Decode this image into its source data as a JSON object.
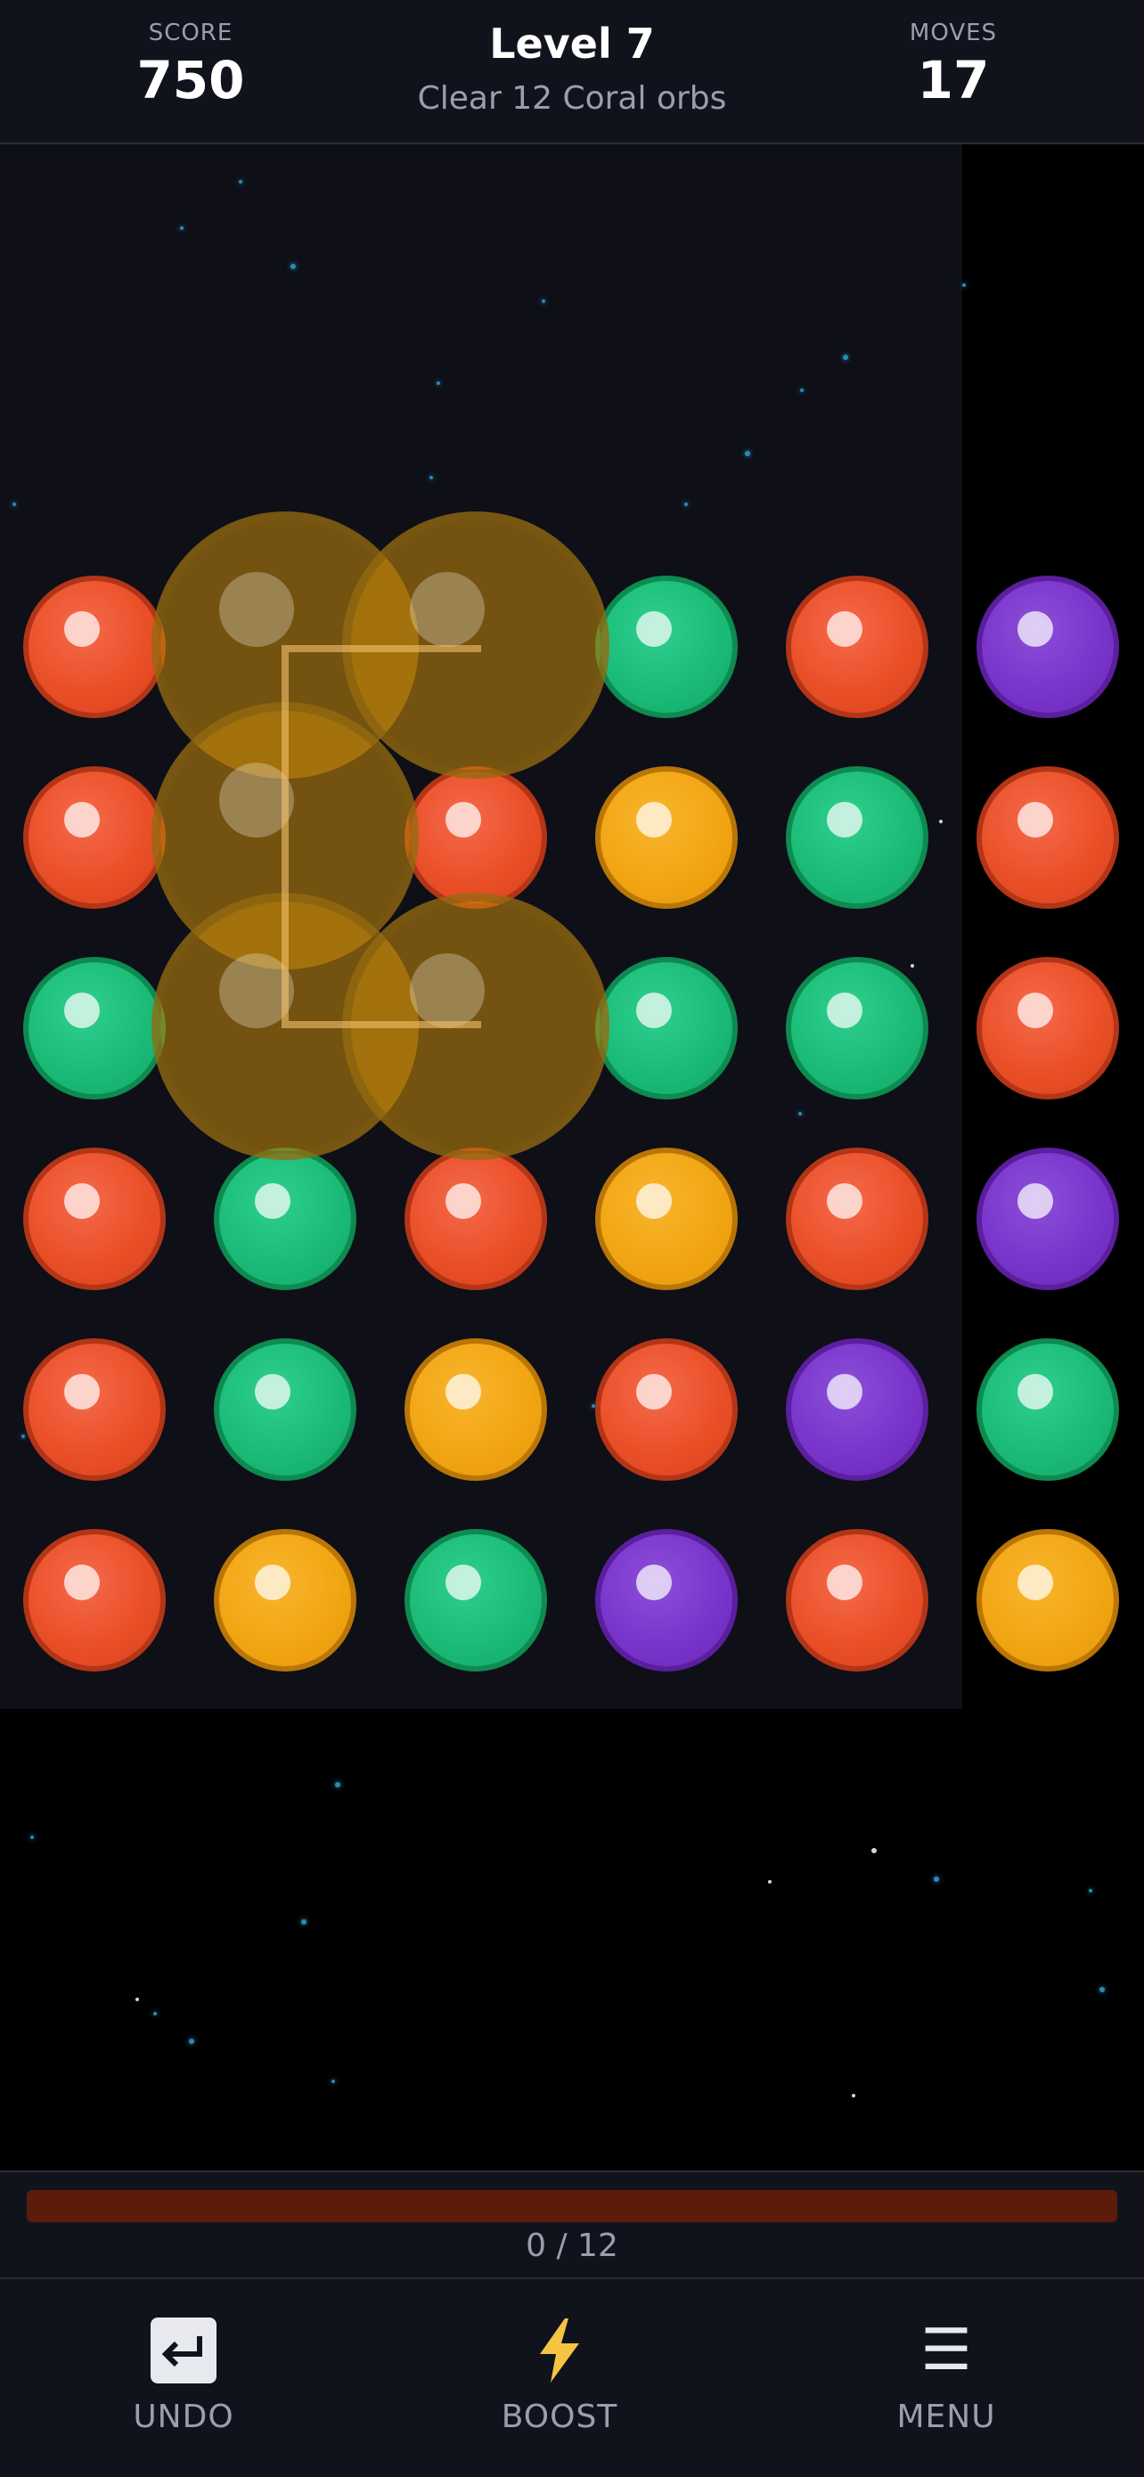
{
  "header": {
    "score_label": "SCORE",
    "score_value": "750",
    "level_title": "Level 7",
    "goal_text": "Clear 12 Coral orbs",
    "moves_label": "MOVES",
    "moves_value": "17"
  },
  "board": {
    "columns": 6,
    "rows": 6,
    "grid": [
      [
        "coral",
        null,
        null,
        "green",
        "coral",
        "purple"
      ],
      [
        "coral",
        null,
        "coral",
        "gold",
        "green",
        "coral"
      ],
      [
        "green",
        null,
        null,
        "green",
        "green",
        "coral"
      ],
      [
        "coral",
        "green",
        "coral",
        "gold",
        "coral",
        "purple"
      ],
      [
        "coral",
        "green",
        "gold",
        "coral",
        "purple",
        "green"
      ],
      [
        "coral",
        "gold",
        "green",
        "purple",
        "coral",
        "gold"
      ]
    ],
    "ghost_orbs_color": "gold",
    "colors": {
      "coral": "#ea5028",
      "green": "#1bbc78",
      "gold": "#f2a613",
      "purple": "#7a35cc"
    }
  },
  "progress": {
    "current": 0,
    "total": 12,
    "text": "0 / 12",
    "fraction": 0
  },
  "bottom_bar": {
    "undo_label": "UNDO",
    "boost_label": "BOOST",
    "menu_label": "MENU",
    "undo_icon": "undo-arrow-icon",
    "boost_icon": "lightning-bolt-icon",
    "menu_icon": "hamburger-menu-icon"
  }
}
